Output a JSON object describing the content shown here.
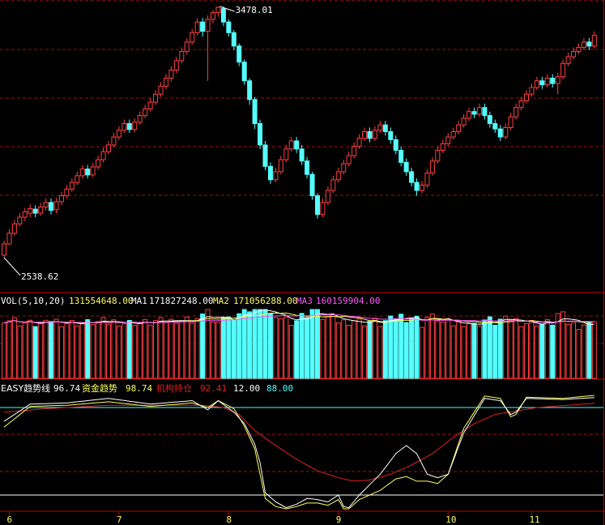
{
  "chart_data": {
    "type": "candlestick",
    "colors": {
      "background": "#000000",
      "up": "#ff4040",
      "down": "#54ffff",
      "grid": "#a01010",
      "border": "#c00000",
      "ma1": "#ffffff",
      "ma2": "#ffff55",
      "ma3": "#ff55ff",
      "easy": "#ffffff",
      "fund": "#ffff60",
      "inst": "#e02020",
      "level_high": "#40ffff",
      "level_low": "#ffffff",
      "axis_text": "#ffff60"
    },
    "price_panel": {
      "max_label": "3478.01",
      "min_label": "2538.62",
      "max_value": 3478.01,
      "min_value": 2538.62,
      "candles": [
        [
          2548,
          2590,
          2538.62,
          2602
        ],
        [
          2590,
          2630,
          2585,
          2645
        ],
        [
          2630,
          2665,
          2620,
          2680
        ],
        [
          2665,
          2690,
          2655,
          2705
        ],
        [
          2690,
          2710,
          2675,
          2725
        ],
        [
          2705,
          2722,
          2690,
          2738
        ],
        [
          2720,
          2705,
          2690,
          2735
        ],
        [
          2705,
          2728,
          2695,
          2745
        ],
        [
          2728,
          2745,
          2715,
          2760
        ],
        [
          2745,
          2715,
          2700,
          2760
        ],
        [
          2718,
          2748,
          2705,
          2762
        ],
        [
          2748,
          2770,
          2735,
          2785
        ],
        [
          2770,
          2795,
          2760,
          2810
        ],
        [
          2795,
          2820,
          2785,
          2835
        ],
        [
          2820,
          2845,
          2810,
          2860
        ],
        [
          2845,
          2870,
          2835,
          2885
        ],
        [
          2870,
          2848,
          2835,
          2885
        ],
        [
          2848,
          2878,
          2840,
          2892
        ],
        [
          2878,
          2905,
          2868,
          2920
        ],
        [
          2905,
          2935,
          2895,
          2950
        ],
        [
          2935,
          2960,
          2925,
          2975
        ],
        [
          2960,
          2990,
          2950,
          3005
        ],
        [
          2990,
          3015,
          2978,
          3030
        ],
        [
          3015,
          3040,
          3005,
          3055
        ],
        [
          3040,
          3018,
          3005,
          3055
        ],
        [
          3018,
          3045,
          3008,
          3060
        ],
        [
          3045,
          3070,
          3035,
          3085
        ],
        [
          3070,
          3095,
          3060,
          3110
        ],
        [
          3095,
          3120,
          3085,
          3135
        ],
        [
          3120,
          3150,
          3110,
          3165
        ],
        [
          3150,
          3180,
          3140,
          3195
        ],
        [
          3180,
          3210,
          3168,
          3225
        ],
        [
          3210,
          3240,
          3198,
          3255
        ],
        [
          3240,
          3275,
          3228,
          3290
        ],
        [
          3275,
          3310,
          3265,
          3325
        ],
        [
          3310,
          3345,
          3298,
          3360
        ],
        [
          3345,
          3380,
          3335,
          3395
        ],
        [
          3380,
          3420,
          3370,
          3435
        ],
        [
          3420,
          3385,
          3365,
          3435
        ],
        [
          3385,
          3430,
          3200,
          3445
        ],
        [
          3430,
          3455,
          3415,
          3465
        ],
        [
          3455,
          3475,
          3440,
          3478.01
        ],
        [
          3470,
          3420,
          3405,
          3478
        ],
        [
          3420,
          3380,
          3365,
          3430
        ],
        [
          3380,
          3330,
          3315,
          3390
        ],
        [
          3330,
          3270,
          3255,
          3340
        ],
        [
          3270,
          3200,
          3185,
          3280
        ],
        [
          3200,
          3130,
          3110,
          3210
        ],
        [
          3130,
          3040,
          3020,
          3140
        ],
        [
          3040,
          2960,
          2945,
          3055
        ],
        [
          2960,
          2880,
          2865,
          2975
        ],
        [
          2880,
          2830,
          2815,
          2895
        ],
        [
          2830,
          2860,
          2820,
          2875
        ],
        [
          2860,
          2905,
          2850,
          2920
        ],
        [
          2905,
          2945,
          2895,
          2960
        ],
        [
          2945,
          2975,
          2935,
          2990
        ],
        [
          2975,
          2945,
          2930,
          2990
        ],
        [
          2945,
          2900,
          2885,
          2960
        ],
        [
          2900,
          2850,
          2835,
          2915
        ],
        [
          2850,
          2770,
          2755,
          2860
        ],
        [
          2770,
          2700,
          2685,
          2780
        ],
        [
          2700,
          2745,
          2690,
          2760
        ],
        [
          2745,
          2790,
          2735,
          2805
        ],
        [
          2790,
          2830,
          2780,
          2845
        ],
        [
          2830,
          2860,
          2820,
          2875
        ],
        [
          2860,
          2890,
          2850,
          2905
        ],
        [
          2890,
          2920,
          2880,
          2935
        ],
        [
          2920,
          2955,
          2910,
          2970
        ],
        [
          2955,
          2985,
          2945,
          3000
        ],
        [
          2985,
          3010,
          2975,
          3025
        ],
        [
          3010,
          2985,
          2970,
          3025
        ],
        [
          2985,
          3015,
          2975,
          3030
        ],
        [
          3015,
          3035,
          3005,
          3050
        ],
        [
          3035,
          3010,
          2995,
          3050
        ],
        [
          3010,
          2980,
          2965,
          3025
        ],
        [
          2980,
          2940,
          2925,
          2995
        ],
        [
          2940,
          2895,
          2880,
          2955
        ],
        [
          2895,
          2860,
          2845,
          2910
        ],
        [
          2860,
          2820,
          2805,
          2875
        ],
        [
          2820,
          2790,
          2770,
          2835
        ],
        [
          2790,
          2810,
          2780,
          2825
        ],
        [
          2810,
          2855,
          2800,
          2870
        ],
        [
          2855,
          2900,
          2845,
          2915
        ],
        [
          2900,
          2940,
          2890,
          2955
        ],
        [
          2940,
          2965,
          2930,
          2980
        ],
        [
          2965,
          2990,
          2955,
          3005
        ],
        [
          2990,
          3010,
          2980,
          3025
        ],
        [
          3010,
          3035,
          3000,
          3050
        ],
        [
          3035,
          3060,
          3025,
          3075
        ],
        [
          3060,
          3085,
          3050,
          3100
        ],
        [
          3085,
          3075,
          3060,
          3100
        ],
        [
          3075,
          3100,
          3065,
          3115
        ],
        [
          3100,
          3070,
          3055,
          3115
        ],
        [
          3070,
          3040,
          3025,
          3085
        ],
        [
          3040,
          3020,
          3005,
          3055
        ],
        [
          3020,
          2990,
          2975,
          3035
        ],
        [
          2990,
          3025,
          2980,
          3040
        ],
        [
          3025,
          3065,
          3015,
          3080
        ],
        [
          3065,
          3100,
          3055,
          3115
        ],
        [
          3100,
          3125,
          3090,
          3140
        ],
        [
          3125,
          3150,
          3115,
          3165
        ],
        [
          3150,
          3175,
          3140,
          3190
        ],
        [
          3175,
          3200,
          3165,
          3215
        ],
        [
          3200,
          3185,
          3170,
          3215
        ],
        [
          3185,
          3210,
          3175,
          3225
        ],
        [
          3210,
          3190,
          3175,
          3225
        ],
        [
          3190,
          3215,
          3150,
          3230
        ],
        [
          3215,
          3265,
          3205,
          3280
        ],
        [
          3265,
          3290,
          3255,
          3305
        ],
        [
          3290,
          3310,
          3280,
          3325
        ],
        [
          3310,
          3325,
          3300,
          3340
        ],
        [
          3325,
          3345,
          3315,
          3360
        ],
        [
          3345,
          3330,
          3315,
          3360
        ],
        [
          3330,
          3370,
          3320,
          3385
        ]
      ]
    },
    "volume_panel": {
      "title": "VOL(5,10,20)",
      "value": "131554648.00",
      "ma1_label": "MA1",
      "ma1_value": "171827248.00",
      "ma2_label": "MA2",
      "ma2_value": "171056288.00",
      "ma3_label": "MA3",
      "ma3_value": "160159904.00",
      "max_value": 220000000
    },
    "indicator_panel": {
      "name": "EASY趋势线",
      "name_value": "96.74",
      "fund_label": "资金趋势",
      "fund_value": "98.74",
      "inst_label": "机构持仓",
      "inst_value": "92.41",
      "level_low": "12.00",
      "level_high": "88.00",
      "ylim": [
        0,
        100
      ],
      "easy_keys": [
        [
          0,
          76
        ],
        [
          5,
          91
        ],
        [
          12,
          92
        ],
        [
          20,
          96
        ],
        [
          28,
          91
        ],
        [
          36,
          94
        ],
        [
          39,
          86
        ],
        [
          41,
          94
        ],
        [
          44,
          84
        ],
        [
          46,
          74
        ],
        [
          48,
          56
        ],
        [
          49,
          40
        ],
        [
          50,
          14
        ],
        [
          52,
          6
        ],
        [
          54,
          1
        ],
        [
          56,
          4
        ],
        [
          58,
          9
        ],
        [
          60,
          8
        ],
        [
          62,
          6
        ],
        [
          64,
          12
        ],
        [
          65,
          2
        ],
        [
          66,
          1
        ],
        [
          68,
          12
        ],
        [
          72,
          30
        ],
        [
          75,
          48
        ],
        [
          77,
          55
        ],
        [
          79,
          48
        ],
        [
          81,
          30
        ],
        [
          83,
          27
        ],
        [
          85,
          30
        ],
        [
          88,
          66
        ],
        [
          92,
          96
        ],
        [
          95,
          94
        ],
        [
          97,
          82
        ],
        [
          98,
          84
        ],
        [
          100,
          96
        ],
        [
          107,
          95
        ],
        [
          114,
          97
        ]
      ],
      "fund_keys": [
        [
          0,
          71
        ],
        [
          5,
          89
        ],
        [
          12,
          90
        ],
        [
          20,
          93
        ],
        [
          28,
          89
        ],
        [
          36,
          92
        ],
        [
          39,
          88
        ],
        [
          41,
          94
        ],
        [
          44,
          87
        ],
        [
          46,
          72
        ],
        [
          48,
          52
        ],
        [
          49,
          30
        ],
        [
          50,
          9
        ],
        [
          52,
          2
        ],
        [
          54,
          0
        ],
        [
          56,
          2
        ],
        [
          58,
          5
        ],
        [
          60,
          5
        ],
        [
          62,
          3
        ],
        [
          64,
          8
        ],
        [
          65,
          0
        ],
        [
          66,
          0
        ],
        [
          68,
          8
        ],
        [
          72,
          16
        ],
        [
          75,
          26
        ],
        [
          77,
          28
        ],
        [
          79,
          24
        ],
        [
          81,
          24
        ],
        [
          83,
          22
        ],
        [
          85,
          30
        ],
        [
          88,
          70
        ],
        [
          92,
          98
        ],
        [
          95,
          96
        ],
        [
          97,
          80
        ],
        [
          98,
          82
        ],
        [
          100,
          97
        ],
        [
          107,
          96
        ],
        [
          114,
          99
        ]
      ],
      "inst_keys": [
        [
          0,
          84
        ],
        [
          8,
          87
        ],
        [
          20,
          90
        ],
        [
          38,
          90
        ],
        [
          42,
          88
        ],
        [
          45,
          82
        ],
        [
          48,
          68
        ],
        [
          52,
          55
        ],
        [
          56,
          43
        ],
        [
          60,
          33
        ],
        [
          64,
          27
        ],
        [
          67,
          24
        ],
        [
          70,
          25
        ],
        [
          74,
          30
        ],
        [
          78,
          38
        ],
        [
          82,
          48
        ],
        [
          86,
          62
        ],
        [
          90,
          74
        ],
        [
          94,
          82
        ],
        [
          98,
          85
        ],
        [
          102,
          88
        ],
        [
          108,
          90
        ],
        [
          114,
          92
        ]
      ]
    },
    "x_ticks": [
      {
        "label": "6",
        "index": 1
      },
      {
        "label": "7",
        "index": 22
      },
      {
        "label": "8",
        "index": 43
      },
      {
        "label": "9",
        "index": 64
      },
      {
        "label": "10",
        "index": 85
      },
      {
        "label": "11",
        "index": 101
      }
    ]
  }
}
